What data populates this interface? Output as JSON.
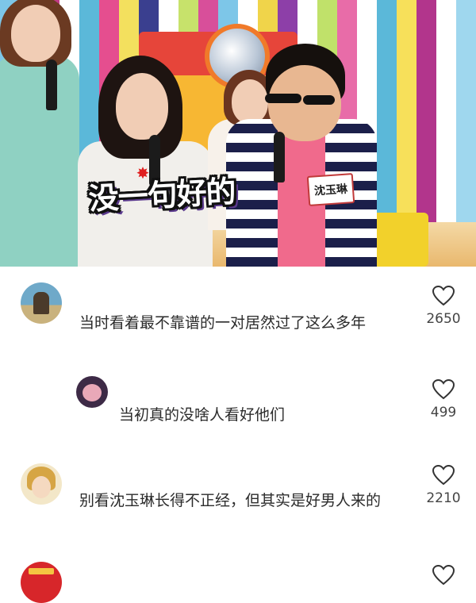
{
  "video": {
    "caption": "没一句好的",
    "name_tag": "沈玉琳",
    "stripe_colors": [
      "#7dc6e8",
      "#f0d44a",
      "#c03a86",
      "#ffffff",
      "#5bb8d9",
      "#e54e8f",
      "#f3e05e",
      "#3a3f8f",
      "#ffffff",
      "#c7e26b",
      "#d84f9a",
      "#7dc6e8",
      "#ffffff",
      "#f0d44a",
      "#8d3fa8",
      "#ffffff",
      "#c0e16a",
      "#e86ca8",
      "#ffffff",
      "#5bb8d9",
      "#f7e05a",
      "#b2358c",
      "#ffffff",
      "#9fd7ee"
    ]
  },
  "comments": [
    {
      "text": "当时看着最不靠谱的一对居然过了这么多年",
      "likes": "2650",
      "avatar": "landscape-avatar"
    },
    {
      "text": "当初真的没啥人看好他们",
      "likes": "499",
      "avatar": "cartoon-avatar"
    },
    {
      "text": "别看沈玉琳长得不正经，但其实是好男人来的",
      "likes": "2210",
      "avatar": "girl-avatar"
    },
    {
      "text": "",
      "likes": "",
      "avatar": "red-avatar"
    }
  ],
  "colors": {
    "like_stroke": "#333333",
    "text": "#2b2b2b"
  }
}
